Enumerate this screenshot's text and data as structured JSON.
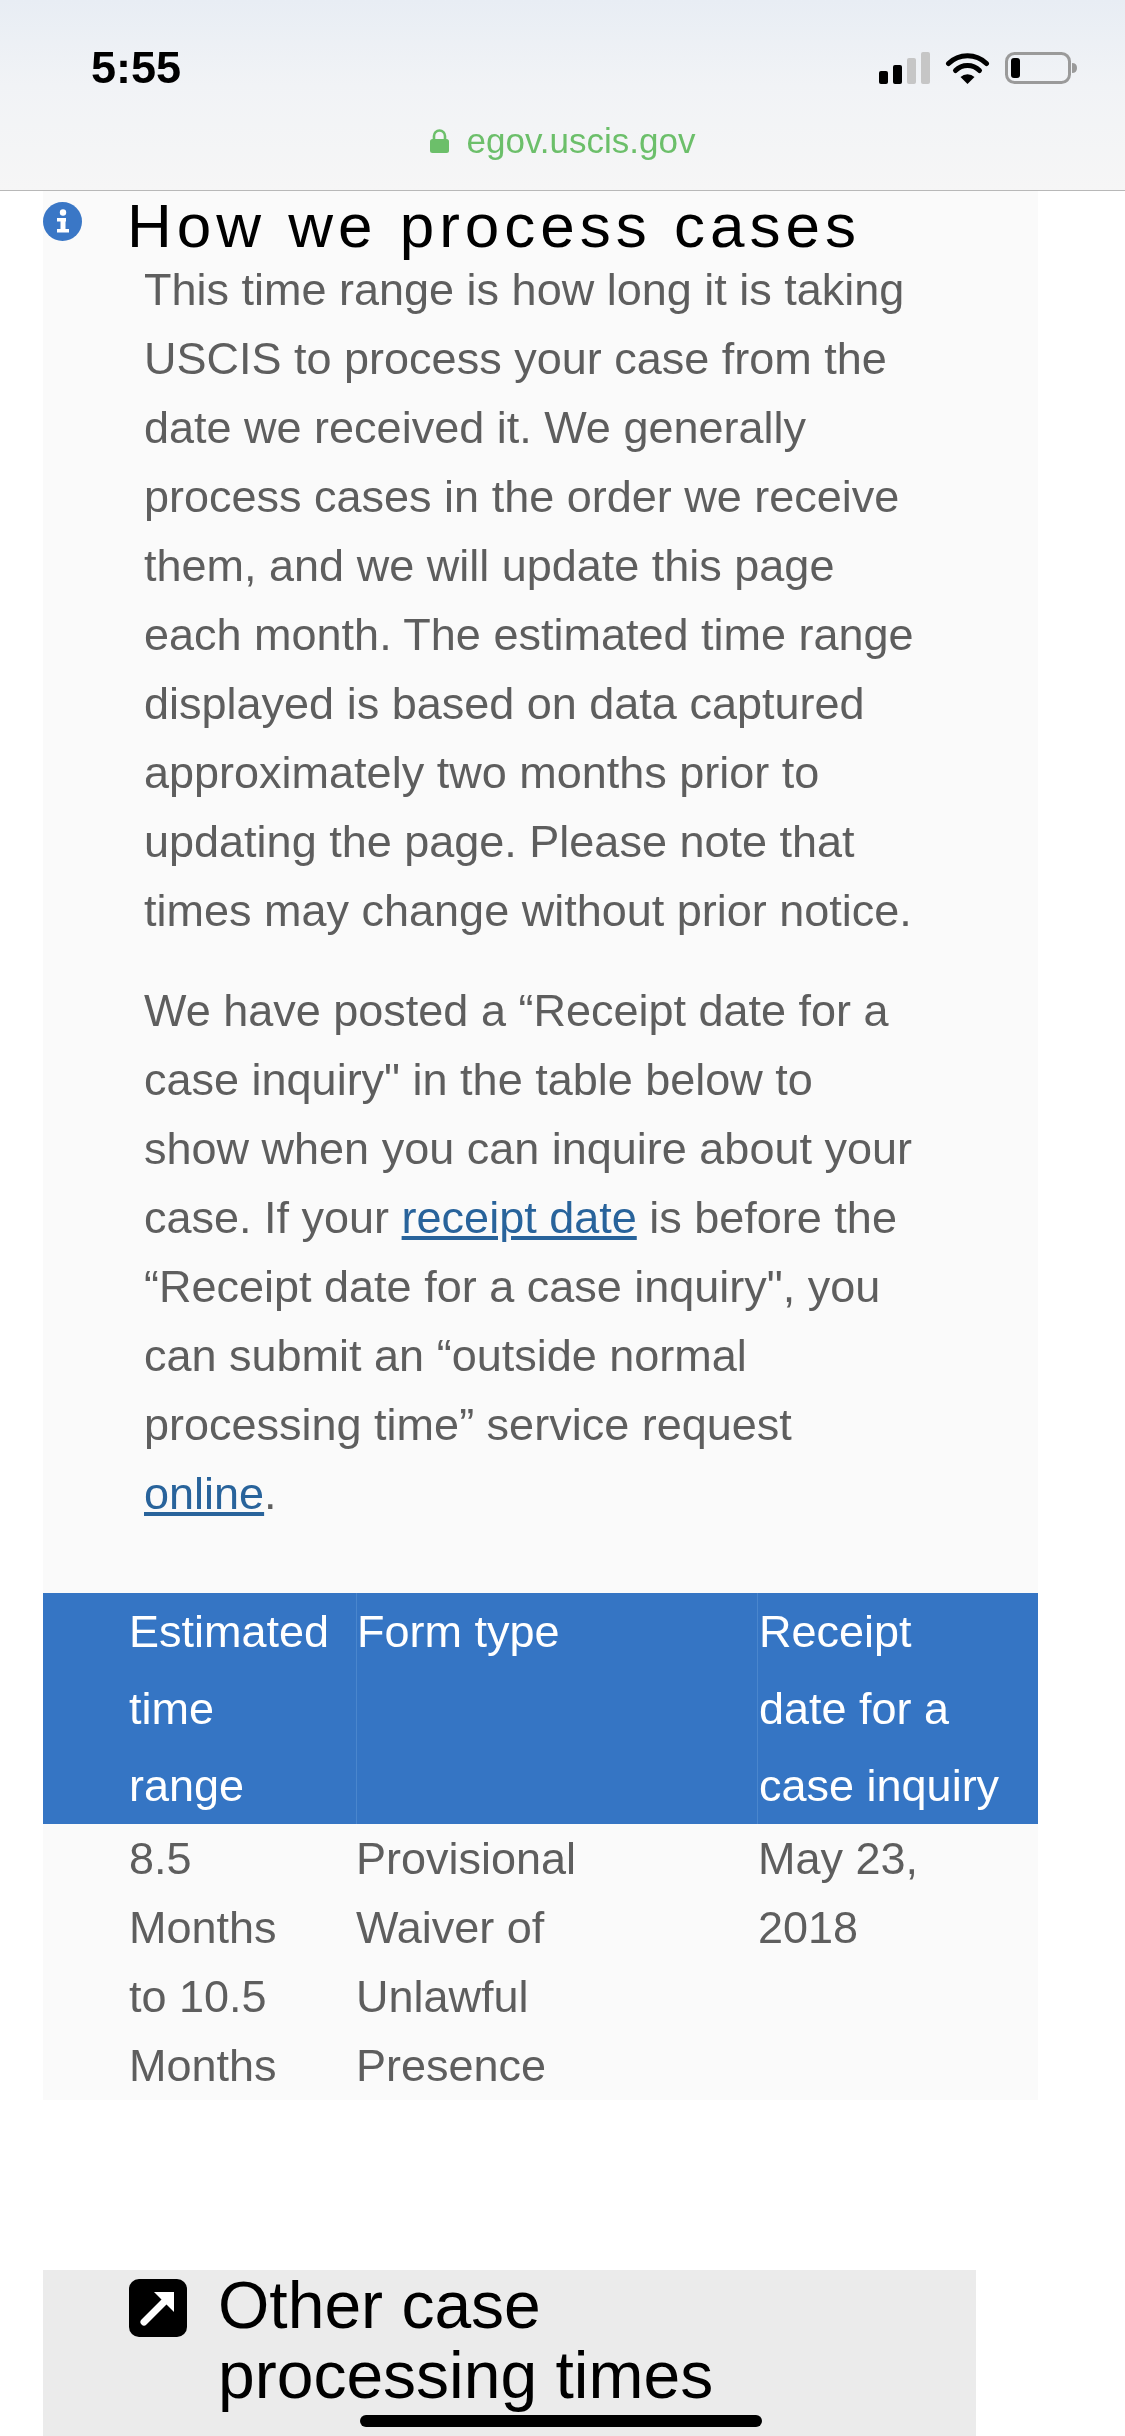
{
  "status_bar": {
    "time": "5:55"
  },
  "address_bar": {
    "url": "egov.uscis.gov",
    "secure": true
  },
  "section": {
    "title": "How we process cases",
    "paragraphs": [
      {
        "parts": [
          {
            "kind": "text",
            "text": "This time range is how long it is taking\nUSCIS to process your case from the\ndate we received it. We generally\nprocess cases in the order we receive\nthem, and we will update this page\neach month. The estimated time range\ndisplayed is based on data captured\napproximately two months prior to\nupdating the page. Please note that\ntimes may change without prior notice."
          }
        ]
      },
      {
        "parts": [
          {
            "kind": "text",
            "text": "We have posted a “Receipt date for a\ncase inquiry\" in the table below to\nshow when you can inquire about your\ncase. If your "
          },
          {
            "kind": "link",
            "text": "receipt date"
          },
          {
            "kind": "text",
            "text": " is before the\n“Receipt date for a case inquiry\", you\ncan submit an “outside normal\nprocessing time” service request\n"
          },
          {
            "kind": "link",
            "text": "online"
          },
          {
            "kind": "text",
            "text": "."
          }
        ]
      }
    ]
  },
  "table": {
    "columns": [
      "Estimated time range",
      "Form type",
      "Receipt date for a case inquiry"
    ],
    "rows": [
      [
        "8.5 Months to 10.5 Months",
        "Provisional Waiver of Unlawful Presence",
        "May 23, 2018"
      ]
    ]
  },
  "related_link": {
    "label": "Other case processing times"
  }
}
